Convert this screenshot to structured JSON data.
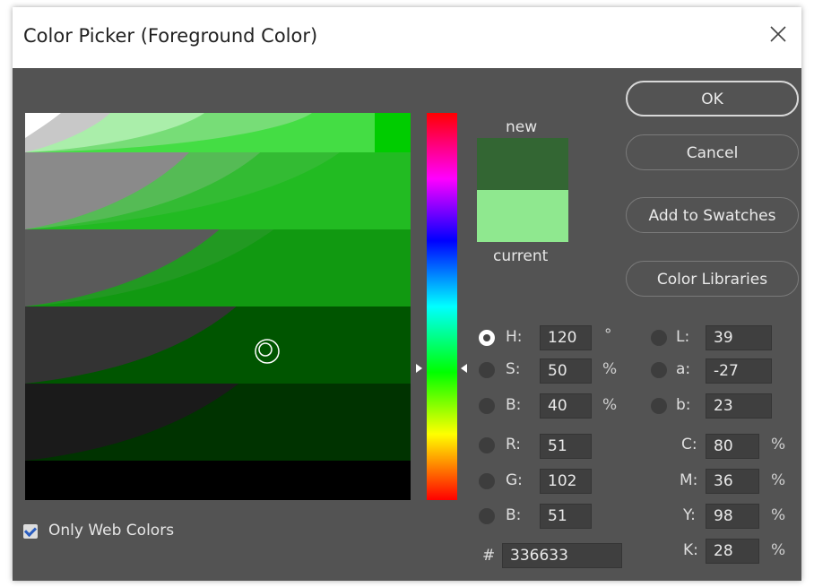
{
  "dialog": {
    "title": "Color Picker (Foreground Color)",
    "close_icon": "close-icon"
  },
  "preview": {
    "new_label": "new",
    "current_label": "current",
    "new_color": "#336633",
    "current_color": "#8fe88f"
  },
  "buttons": {
    "ok": "OK",
    "cancel": "Cancel",
    "add_to_swatches": "Add to Swatches",
    "color_libraries": "Color Libraries"
  },
  "hsb": {
    "h": {
      "label": "H:",
      "value": "120",
      "unit": "°"
    },
    "s": {
      "label": "S:",
      "value": "50",
      "unit": "%"
    },
    "b": {
      "label": "B:",
      "value": "40",
      "unit": "%"
    }
  },
  "rgb": {
    "r": {
      "label": "R:",
      "value": "51"
    },
    "g": {
      "label": "G:",
      "value": "102"
    },
    "b": {
      "label": "B:",
      "value": "51"
    }
  },
  "lab": {
    "l": {
      "label": "L:",
      "value": "39"
    },
    "a": {
      "label": "a:",
      "value": "-27"
    },
    "b": {
      "label": "b:",
      "value": "23"
    }
  },
  "cmyk": {
    "c": {
      "label": "C:",
      "value": "80",
      "unit": "%"
    },
    "m": {
      "label": "M:",
      "value": "36",
      "unit": "%"
    },
    "y": {
      "label": "Y:",
      "value": "98",
      "unit": "%"
    },
    "k": {
      "label": "K:",
      "value": "28",
      "unit": "%"
    }
  },
  "hex": {
    "label": "#",
    "value": "336633"
  },
  "only_web_colors": {
    "label": "Only Web Colors",
    "checked": true
  },
  "colors": {
    "dialog_bg": "#535353",
    "field_base": "#00cc00"
  }
}
